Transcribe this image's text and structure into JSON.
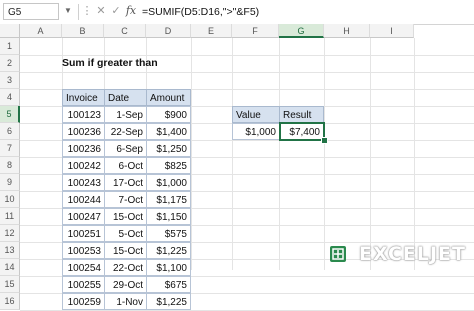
{
  "formula_bar": {
    "name_box": "G5",
    "formula": "=SUMIF(D5:D16,\">\"&F5)"
  },
  "columns": [
    "A",
    "B",
    "C",
    "D",
    "E",
    "F",
    "G",
    "H",
    "I"
  ],
  "rows": [
    "1",
    "2",
    "3",
    "4",
    "5",
    "6",
    "7",
    "8",
    "9",
    "10",
    "11",
    "12",
    "13",
    "14",
    "15",
    "16"
  ],
  "selected": {
    "column": "G",
    "row": "5"
  },
  "sheet": {
    "title": "Sum if greater than",
    "table_headers": [
      "Invoice",
      "Date",
      "Amount"
    ],
    "table_rows": [
      [
        "100123",
        "1-Sep",
        "$900"
      ],
      [
        "100236",
        "22-Sep",
        "$1,400"
      ],
      [
        "100236",
        "6-Sep",
        "$1,250"
      ],
      [
        "100242",
        "6-Oct",
        "$825"
      ],
      [
        "100243",
        "17-Oct",
        "$1,000"
      ],
      [
        "100244",
        "7-Oct",
        "$1,175"
      ],
      [
        "100247",
        "15-Oct",
        "$1,150"
      ],
      [
        "100251",
        "5-Oct",
        "$575"
      ],
      [
        "100253",
        "15-Oct",
        "$1,225"
      ],
      [
        "100254",
        "22-Oct",
        "$1,100"
      ],
      [
        "100255",
        "29-Oct",
        "$675"
      ],
      [
        "100259",
        "1-Nov",
        "$1,225"
      ]
    ],
    "criteria_headers": [
      "Value",
      "Result"
    ],
    "criteria_values": [
      "$1,000",
      "$7,400"
    ]
  },
  "brand": {
    "logo_text": "EXCELJET",
    "accent": "#217346",
    "header_fill": "#d6e1ef"
  },
  "icons": [
    "chevron-down-icon",
    "more-options-icon",
    "cancel-icon",
    "enter-check-icon",
    "function-icon"
  ]
}
